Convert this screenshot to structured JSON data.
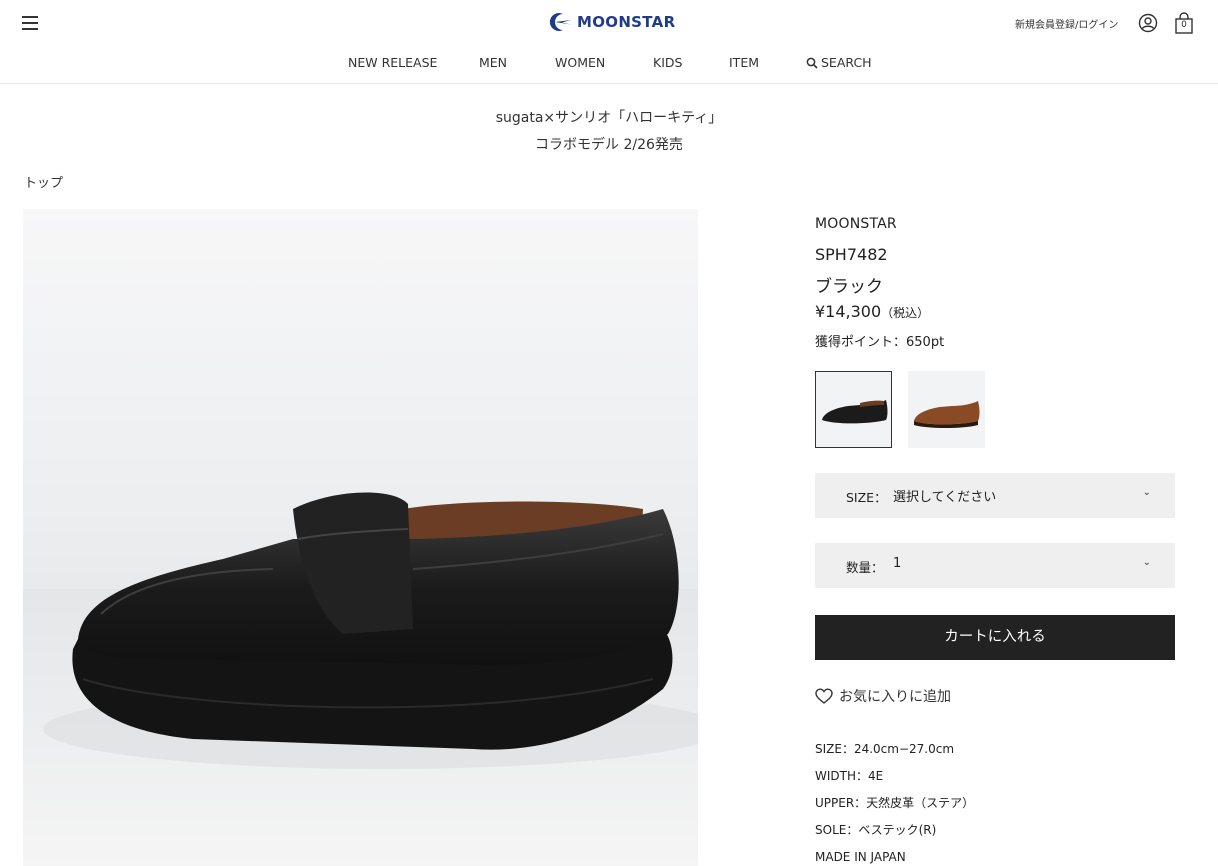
{
  "header": {
    "logo_text": "MOONSTAR",
    "login_link": "新規会員登録/ログイン",
    "cart_count": "0"
  },
  "nav": {
    "items": [
      "NEW RELEASE",
      "MEN",
      "WOMEN",
      "KIDS",
      "ITEM"
    ],
    "search_label": "SEARCH"
  },
  "promo": {
    "line1": "sugata×サンリオ「ハローキティ」",
    "line2": "コラボモデル 2/26発売"
  },
  "breadcrumb": "トップ",
  "product": {
    "brand": "MOONSTAR",
    "code": "SPH7482",
    "color": "ブラック",
    "price": "¥14,300",
    "tax_note": "（税込）",
    "points": "獲得ポイント：650pt"
  },
  "size_select": {
    "label": "SIZE：",
    "value": "選択してください"
  },
  "qty_select": {
    "label": "数量：",
    "value": "1"
  },
  "cart_button": "カートに入れる",
  "favorite": "お気に入りに追加",
  "specs": [
    "SIZE：24.0cm−27.0cm",
    "WIDTH：4E",
    "UPPER：天然皮革（ステア）",
    "SOLE：ベステック(R)",
    "MADE IN JAPAN"
  ],
  "colors": {
    "accent": "#222222",
    "logo": "#1f3c8c",
    "select_bg": "#efefef"
  }
}
